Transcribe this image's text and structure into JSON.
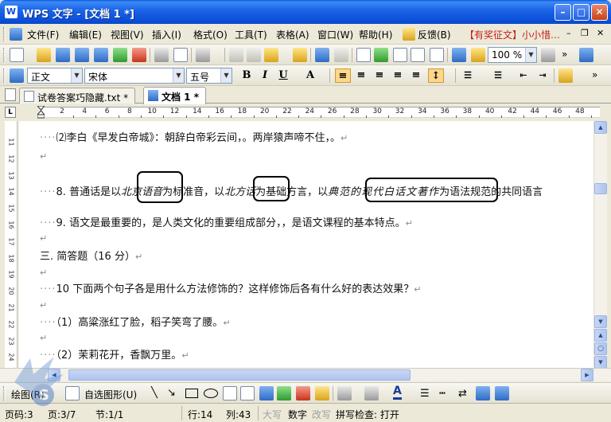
{
  "window": {
    "title": "WPS 文字 - [文档 1 *]"
  },
  "menu": {
    "items": [
      "文件(F)",
      "编辑(E)",
      "视图(V)",
      "插入(I)",
      "格式(O)",
      "工具(T)",
      "表格(A)",
      "窗口(W)",
      "帮助(H)"
    ],
    "feedback": "反馈(B)",
    "promo": "【有奖征文】小小惜…"
  },
  "toolbar": {
    "zoom": "100 %"
  },
  "format": {
    "style": "正文",
    "font": "宋体",
    "size": "五号",
    "bold": "B",
    "italic": "I",
    "underline": "U",
    "font_color": "A"
  },
  "tabs": [
    {
      "label": "试卷答案巧隐藏.txt *"
    },
    {
      "label": "文档 1 *"
    }
  ],
  "ruler": {
    "numbers": [
      "2",
      "4",
      "6",
      "8",
      "10",
      "12",
      "14",
      "16",
      "18",
      "20",
      "22",
      "24",
      "26",
      "28",
      "30",
      "32",
      "34",
      "36",
      "38",
      "40",
      "42",
      "44",
      "46",
      "48"
    ],
    "vnumbers": [
      "11",
      "12",
      "13",
      "14",
      "15",
      "16",
      "17",
      "18",
      "19",
      "20",
      "21",
      "22",
      "23",
      "24",
      "25"
    ]
  },
  "document": {
    "line1": "⑵李白《早发白帝城》：朝辞白帝彩云间，。两岸猿声啼不住，。",
    "line3_pre": "8. 普通话是以",
    "line3_a": "北京语音",
    "line3_mid1": "为标准音，以",
    "line3_b": "北方话",
    "line3_mid2": "为基础方言，以",
    "line3_c": "典范的现代白话文著作",
    "line3_post": "为语法规范的共同语言",
    "line4": "9. 语文是最重要的，是人类文化的重要组成部分，，是语文课程的基本特点。",
    "line6": "三. 简答题（16 分）",
    "line8": "10 下面两个句子各是用什么方法修饰的？这样修饰后各有什么好的表达效果？",
    "line10": "（1）高粱涨红了脸，稻子笑弯了腰。",
    "line12": "（2）茉莉花开，香飘万里。",
    "para_mark": "↵"
  },
  "drawing": {
    "draw": "绘图(R)",
    "autoshape": "自选图形(U)"
  },
  "status": {
    "page": "页码:3",
    "pages": "页:3/7",
    "section": "节:1/1",
    "row": "行:14",
    "col": "列:43",
    "caps": "大写",
    "num": "数字",
    "ovr": "改写",
    "spell": "拼写检查: 打开"
  }
}
